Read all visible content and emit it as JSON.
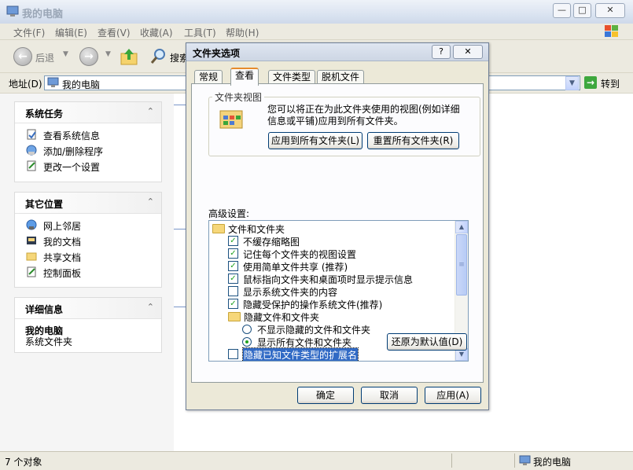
{
  "window": {
    "title": "我的电脑",
    "controls": {
      "min": "—",
      "max": "□",
      "close": "✕"
    }
  },
  "menu": [
    "文件(F)",
    "编辑(E)",
    "查看(V)",
    "收藏(A)",
    "工具(T)",
    "帮助(H)"
  ],
  "toolbar": {
    "back": "后退",
    "search": "搜索"
  },
  "address": {
    "label": "地址(D)",
    "value": "我的电脑",
    "go": "转到"
  },
  "sidebar": {
    "system_tasks": {
      "title": "系统任务",
      "items": [
        "查看系统信息",
        "添加/删除程序",
        "更改一个设置"
      ]
    },
    "other_places": {
      "title": "其它位置",
      "items": [
        "网上邻居",
        "我的文档",
        "共享文档",
        "控制面板"
      ]
    },
    "details": {
      "title": "详细信息",
      "name": "我的电脑",
      "desc": "系统文件夹"
    }
  },
  "statusbar": {
    "left": "7 个对象",
    "right": "我的电脑"
  },
  "dialog": {
    "title": "文件夹选项",
    "tabs": [
      "常规",
      "查看",
      "文件类型",
      "脱机文件"
    ],
    "active_tab": 1,
    "folder_views": {
      "label": "文件夹视图",
      "desc": "您可以将正在为此文件夹使用的视图(例如详细信息或平铺)应用到所有文件夹。",
      "apply_all": "应用到所有文件夹(L)",
      "reset_all": "重置所有文件夹(R)"
    },
    "advanced_label": "高级设置:",
    "tree": [
      {
        "type": "folder",
        "indent": 0,
        "label": "文件和文件夹"
      },
      {
        "type": "check",
        "indent": 1,
        "label": "不缓存缩略图",
        "checked": true
      },
      {
        "type": "check",
        "indent": 1,
        "label": "记住每个文件夹的视图设置",
        "checked": true
      },
      {
        "type": "check",
        "indent": 1,
        "label": "使用简单文件共享 (推荐)",
        "checked": true
      },
      {
        "type": "check",
        "indent": 1,
        "label": "鼠标指向文件夹和桌面项时显示提示信息",
        "checked": true
      },
      {
        "type": "check",
        "indent": 1,
        "label": "显示系统文件夹的内容",
        "checked": false
      },
      {
        "type": "check",
        "indent": 1,
        "label": "隐藏受保护的操作系统文件(推荐)",
        "checked": true
      },
      {
        "type": "folder",
        "indent": 1,
        "label": "隐藏文件和文件夹"
      },
      {
        "type": "radio",
        "indent": 2,
        "label": "不显示隐藏的文件和文件夹",
        "checked": false
      },
      {
        "type": "radio",
        "indent": 2,
        "label": "显示所有文件和文件夹",
        "checked": true
      },
      {
        "type": "check",
        "indent": 1,
        "label": "隐藏已知文件类型的扩展名",
        "checked": false,
        "selected": true
      }
    ],
    "restore_defaults": "还原为默认值(D)",
    "buttons": {
      "ok": "确定",
      "cancel": "取消",
      "apply": "应用(A)"
    }
  }
}
